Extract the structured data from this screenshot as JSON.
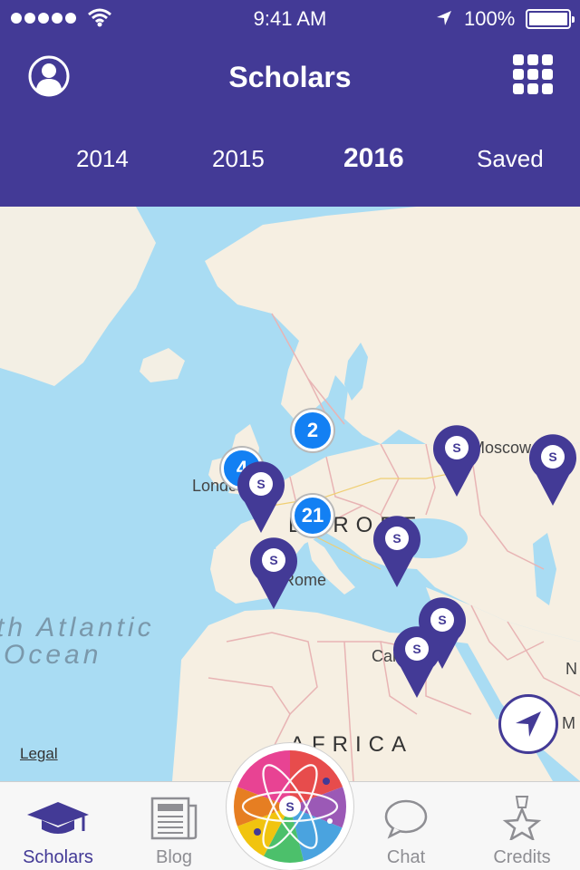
{
  "status": {
    "time": "9:41 AM",
    "battery": "100%"
  },
  "header": {
    "title": "Scholars"
  },
  "tabs": [
    {
      "label": "2014",
      "active": false
    },
    {
      "label": "2015",
      "active": false
    },
    {
      "label": "2016",
      "active": true
    },
    {
      "label": "Saved",
      "active": false
    }
  ],
  "map": {
    "labels": {
      "europe": "EUROPE",
      "africa": "AFRICA",
      "atlantic_1": "th Atlantic",
      "atlantic_2": "Ocean",
      "london": "London",
      "rome": "Rome",
      "moscow": "Moscow",
      "cairo": "Cairo",
      "edge_n": "N",
      "edge_m": "M"
    },
    "legal": "Legal",
    "clusters": [
      "2",
      "4",
      "21"
    ],
    "pin_letter": "S"
  },
  "colors": {
    "brand": "#433a96",
    "cluster": "#1380f3"
  },
  "tabbar": [
    {
      "label": "Scholars",
      "icon": "graduation-cap-icon",
      "active": true
    },
    {
      "label": "Blog",
      "icon": "newspaper-icon",
      "active": false
    },
    {
      "label": "",
      "icon": "atom-logo-icon",
      "active": false
    },
    {
      "label": "Chat",
      "icon": "speech-bubble-icon",
      "active": false
    },
    {
      "label": "Credits",
      "icon": "medal-star-icon",
      "active": false
    }
  ]
}
